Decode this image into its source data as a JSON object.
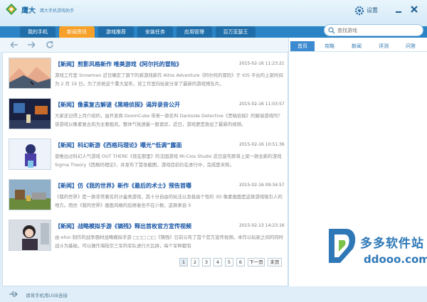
{
  "app": {
    "name": "鹰大",
    "subtitle": "鹰大手机游戏助手",
    "settings_label": "设置"
  },
  "nav": {
    "tabs": [
      {
        "label": "我的手机"
      },
      {
        "label": "新闻资讯"
      },
      {
        "label": "游戏推荐"
      },
      {
        "label": "安装任务"
      },
      {
        "label": "应用管理"
      },
      {
        "label": "百万亚瑟王"
      }
    ],
    "active_index": 1
  },
  "search": {
    "placeholder": "查找游戏"
  },
  "news": [
    {
      "title": "【新闻】剪影风格新作 唯美游戏《阿尔托的冒险》",
      "date": "2015-02-16 11:23:21",
      "desc": "游戏工作室 Snowman 近日确定了旗下的新游戏新作 Altos Adventure《阿尔托的冒险》于 iOS 平台的上架时间为 2 月 19 日。为了庆祝这个重大宣布，该工作室向玩家分享了最新的游戏预告片。"
    },
    {
      "title": "【新闻】像素复古解谜《黑暗侦探》谒异录音公开",
      "date": "2015-02-16 11:03:57",
      "desc": "大家还记得上月介绍的，由开发商 DoomCube 带来一款名叫 Darkside Detective《黑暗侦探》的解谜游戏吗？该游戏以像素复古风为主要画风，整体气氛透着一股诡异，近日，游戏更是放出了最新的视频。"
    },
    {
      "title": "【新闻】科幻新游《西格玛理论》曝光“低调”露面",
      "date": "2015-02-16 10:51:36",
      "desc": "曾推出过科幻人气游戏 OUT THERE《就在那里》的法国游戏 Mi-Clos Studio 近日宣布即将上架一款全新的游戏 Sigma Theory《西格玛理论》，并发布了首张截图，游戏目前仍在进行中，完成度未知。"
    },
    {
      "title": "【新闻】仿《我的世界》新作《最后的术士》预告首曝",
      "date": "2015-02-16 09:34:57",
      "desc": "《我的世界》是一款非常著名的沙盒类游戏，其十分自由的玩法以及极具个性的 3D 像素画面是这款游戏吸引人的地方。而仿《我的世界》画面风格的后继者也不在少数，这款来自 S"
    },
    {
      "title": "【新闻】战略模拟手游《镝残》释出首枚官方宣传视频",
      "date": "2015-02-13 14:23:16",
      "desc": "由 efun 制作的战争题材战略模拟手游 □□□ □□《镝残》日前公布了首个官方宣传视频。本作以玩家之间的同时战斗为基础，可以操作海陆空三军的军队进行大比拼，每个军种都有"
    }
  ],
  "pager": {
    "pages": [
      "1",
      "2",
      "3",
      "4",
      "5",
      "6"
    ],
    "current": "1",
    "next_label": "下一页",
    "last_label": "末页"
  },
  "right_tabs": [
    {
      "label": "首页"
    },
    {
      "label": "攻略"
    },
    {
      "label": "新闻"
    },
    {
      "label": "评测"
    },
    {
      "label": "问答"
    }
  ],
  "watermark": {
    "line1": "多多软件站",
    "line2": "ddooo.com"
  },
  "status": {
    "text": "请将手机用USB连接"
  },
  "colors": {
    "nav_bg": "#2a84c6",
    "active_tab": "#f7a12a",
    "title_blue": "#1a57a7",
    "accent": "#3c8ad0"
  }
}
